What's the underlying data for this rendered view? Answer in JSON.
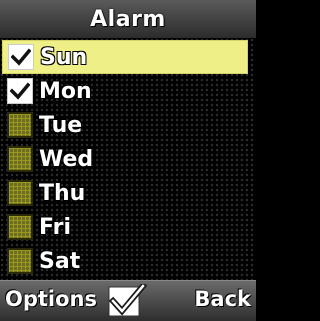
{
  "title": "Alarm",
  "days": [
    {
      "label": "Sun",
      "checked": true,
      "selected": true
    },
    {
      "label": "Mon",
      "checked": true,
      "selected": false
    },
    {
      "label": "Tue",
      "checked": false,
      "selected": false
    },
    {
      "label": "Wed",
      "checked": false,
      "selected": false
    },
    {
      "label": "Thu",
      "checked": false,
      "selected": false
    },
    {
      "label": "Fri",
      "checked": false,
      "selected": false
    },
    {
      "label": "Sat",
      "checked": false,
      "selected": false
    }
  ],
  "softkeys": {
    "left": "Options",
    "center_icon": "checkmark-icon",
    "right": "Back"
  },
  "colors": {
    "highlight": "#efef88",
    "checkbox_unchecked": "#6f6e18"
  }
}
